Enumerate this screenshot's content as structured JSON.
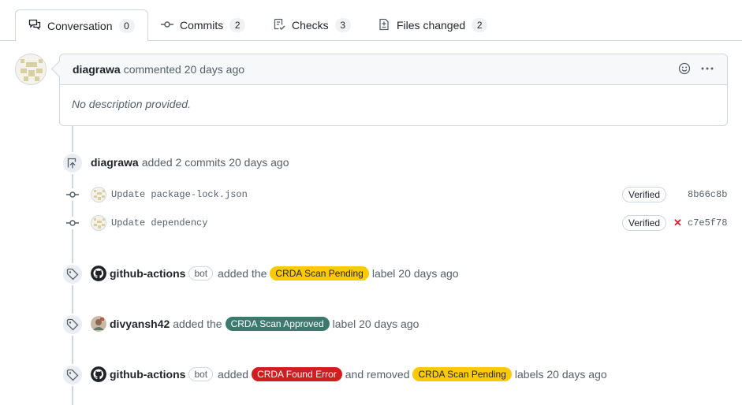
{
  "tabs": [
    {
      "label": "Conversation",
      "count": "0",
      "icon": "comment-discussion-icon"
    },
    {
      "label": "Commits",
      "count": "2",
      "icon": "git-commit-icon"
    },
    {
      "label": "Checks",
      "count": "3",
      "icon": "checklist-icon"
    },
    {
      "label": "Files changed",
      "count": "2",
      "icon": "file-diff-icon"
    }
  ],
  "comment": {
    "author": "diagrawa",
    "action": "commented 20 days ago",
    "body": "No description provided."
  },
  "commits_event": {
    "author": "diagrawa",
    "text": "added 2 commits 20 days ago",
    "commits": [
      {
        "message": "Update package-lock.json",
        "badge": "Verified",
        "sha": "8b66c8b",
        "status": ""
      },
      {
        "message": "Update dependency",
        "badge": "Verified",
        "sha": "c7e5f78",
        "status": "✕"
      }
    ]
  },
  "events": [
    {
      "actor": "github-actions",
      "bot": "bot",
      "pre": "added the",
      "label": "CRDA Scan Pending",
      "post": "label 20 days ago"
    },
    {
      "actor": "divyansh42",
      "pre": "added the",
      "label": "CRDA Scan Approved",
      "post": "label 20 days ago"
    },
    {
      "actor": "github-actions",
      "bot": "bot",
      "pre": "added",
      "label": "CRDA Found Error",
      "mid": "and removed",
      "label2": "CRDA Scan Pending",
      "post": "labels 20 days ago"
    }
  ],
  "colors": {
    "pending": "#fbca04",
    "approved": "#3d7a6e",
    "error": "#d11d1d",
    "accent": "#0969da"
  }
}
